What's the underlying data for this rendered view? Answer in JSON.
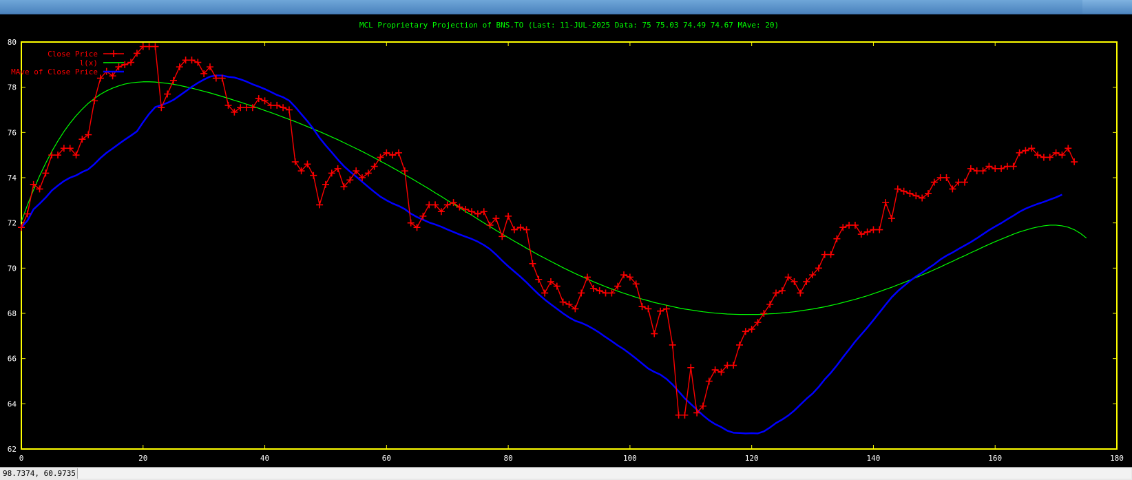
{
  "chart_data": {
    "type": "line",
    "title": "MCL Proprietary Projection of BNS.TO  (Last: 11-JUL-2025    Data: 75 75.03 74.49 74.67    MAve: 20)",
    "xlim": [
      0,
      180
    ],
    "ylim": [
      62,
      80
    ],
    "x_ticks": [
      "0",
      "20",
      "40",
      "60",
      "80",
      "100",
      "120",
      "140",
      "160",
      "180"
    ],
    "y_ticks": [
      "62",
      "64",
      "66",
      "68",
      "70",
      "72",
      "74",
      "76",
      "78",
      "80"
    ],
    "grid": false,
    "legend_position": "top-left",
    "series": [
      {
        "name": "Close Price",
        "color": "#ff0000",
        "marker": "+",
        "values": [
          71.8,
          72.4,
          73.7,
          73.5,
          74.2,
          75.0,
          75.0,
          75.3,
          75.3,
          75.0,
          75.7,
          75.9,
          77.4,
          78.4,
          78.7,
          78.5,
          78.9,
          79.0,
          79.1,
          79.5,
          79.8,
          79.8,
          79.8,
          77.1,
          77.7,
          78.3,
          78.9,
          79.2,
          79.2,
          79.1,
          78.6,
          78.9,
          78.4,
          78.4,
          77.2,
          76.9,
          77.1,
          77.1,
          77.1,
          77.5,
          77.4,
          77.2,
          77.2,
          77.1,
          77.0,
          74.7,
          74.3,
          74.6,
          74.1,
          72.8,
          73.7,
          74.2,
          74.4,
          73.6,
          73.9,
          74.3,
          74.0,
          74.2,
          74.5,
          74.9,
          75.1,
          75.0,
          75.1,
          74.3,
          72.0,
          71.8,
          72.3,
          72.8,
          72.8,
          72.5,
          72.8,
          72.9,
          72.7,
          72.6,
          72.5,
          72.4,
          72.5,
          71.9,
          72.2,
          71.4,
          72.3,
          71.7,
          71.8,
          71.7,
          70.2,
          69.5,
          68.9,
          69.4,
          69.2,
          68.5,
          68.4,
          68.2,
          68.9,
          69.6,
          69.1,
          69.0,
          68.9,
          68.9,
          69.2,
          69.7,
          69.6,
          69.3,
          68.3,
          68.2,
          67.1,
          68.1,
          68.2,
          66.6,
          63.5,
          63.5,
          65.6,
          63.6,
          63.9,
          65.0,
          65.5,
          65.4,
          65.7,
          65.7,
          66.6,
          67.2,
          67.3,
          67.6,
          68.0,
          68.4,
          68.9,
          69.0,
          69.6,
          69.4,
          68.9,
          69.4,
          69.7,
          70.0,
          70.6,
          70.6,
          71.3,
          71.8,
          71.9,
          71.9,
          71.5,
          71.6,
          71.7,
          71.7,
          72.9,
          72.2,
          73.5,
          73.4,
          73.3,
          73.2,
          73.1,
          73.3,
          73.8,
          74.0,
          74.0,
          73.5,
          73.8,
          73.8,
          74.4,
          74.3,
          74.3,
          74.5,
          74.4,
          74.4,
          74.5,
          74.5,
          75.1,
          75.2,
          75.3,
          75.0,
          74.9,
          74.9,
          75.1,
          75.0,
          75.3,
          74.7
        ]
      },
      {
        "name": "l(x)",
        "color": "#00ff00",
        "values": [
          72.06,
          72.79,
          73.46,
          74.08,
          74.64,
          75.16,
          75.62,
          76.04,
          76.41,
          76.74,
          77.03,
          77.29,
          77.5,
          77.69,
          77.84,
          77.96,
          78.06,
          78.14,
          78.19,
          78.22,
          78.24,
          78.24,
          78.23,
          78.2,
          78.17,
          78.13,
          78.08,
          78.02,
          77.96,
          77.89,
          77.82,
          77.75,
          77.67,
          77.59,
          77.51,
          77.42,
          77.34,
          77.25,
          77.16,
          77.07,
          76.97,
          76.88,
          76.78,
          76.68,
          76.58,
          76.48,
          76.37,
          76.26,
          76.15,
          76.04,
          75.92,
          75.8,
          75.68,
          75.55,
          75.42,
          75.29,
          75.16,
          75.02,
          74.88,
          74.73,
          74.59,
          74.44,
          74.29,
          74.13,
          73.98,
          73.82,
          73.66,
          73.5,
          73.33,
          73.17,
          73.0,
          72.84,
          72.67,
          72.5,
          72.34,
          72.17,
          72.0,
          71.84,
          71.67,
          71.51,
          71.35,
          71.19,
          71.04,
          70.88,
          70.73,
          70.58,
          70.44,
          70.3,
          70.16,
          70.02,
          69.89,
          69.76,
          69.64,
          69.52,
          69.4,
          69.29,
          69.18,
          69.08,
          68.98,
          68.89,
          68.8,
          68.71,
          68.63,
          68.56,
          68.48,
          68.42,
          68.36,
          68.3,
          68.24,
          68.19,
          68.15,
          68.11,
          68.07,
          68.04,
          68.01,
          67.99,
          67.97,
          67.96,
          67.95,
          67.95,
          67.95,
          67.95,
          67.96,
          67.98,
          67.99,
          68.02,
          68.04,
          68.07,
          68.11,
          68.15,
          68.19,
          68.24,
          68.29,
          68.35,
          68.41,
          68.48,
          68.55,
          68.62,
          68.7,
          68.78,
          68.87,
          68.96,
          69.06,
          69.15,
          69.26,
          69.36,
          69.47,
          69.58,
          69.7,
          69.81,
          69.93,
          70.05,
          70.18,
          70.3,
          70.43,
          70.55,
          70.68,
          70.8,
          70.93,
          71.05,
          71.17,
          71.28,
          71.39,
          71.5,
          71.6,
          71.68,
          71.76,
          71.82,
          71.87,
          71.9,
          71.9,
          71.87,
          71.81,
          71.7,
          71.54,
          71.33
        ]
      },
      {
        "name": "MAve of Close Price",
        "color": "#0000ff",
        "values": [
          71.8,
          72.1,
          72.6,
          72.85,
          73.12,
          73.43,
          73.65,
          73.85,
          74.0,
          74.1,
          74.25,
          74.37,
          74.6,
          74.87,
          75.1,
          75.29,
          75.49,
          75.68,
          75.86,
          76.05,
          76.45,
          76.82,
          77.12,
          77.21,
          77.31,
          77.44,
          77.63,
          77.82,
          78.02,
          78.19,
          78.34,
          78.47,
          78.52,
          78.52,
          78.46,
          78.43,
          78.35,
          78.25,
          78.13,
          78.03,
          77.92,
          77.79,
          77.66,
          77.56,
          77.41,
          77.13,
          76.81,
          76.5,
          76.15,
          75.76,
          75.43,
          75.12,
          74.8,
          74.51,
          74.27,
          74.05,
          73.82,
          73.59,
          73.37,
          73.16,
          73.0,
          72.86,
          72.75,
          72.61,
          72.41,
          72.26,
          72.14,
          72.02,
          71.93,
          71.83,
          71.71,
          71.6,
          71.49,
          71.39,
          71.29,
          71.17,
          71.02,
          70.84,
          70.6,
          70.33,
          70.08,
          69.85,
          69.62,
          69.37,
          69.1,
          68.84,
          68.61,
          68.4,
          68.2,
          68.0,
          67.82,
          67.67,
          67.58,
          67.46,
          67.31,
          67.14,
          66.95,
          66.77,
          66.58,
          66.41,
          66.21,
          66.0,
          65.78,
          65.56,
          65.41,
          65.29,
          65.1,
          64.85,
          64.55,
          64.24,
          63.99,
          63.74,
          63.49,
          63.27,
          63.1,
          62.97,
          62.81,
          62.72,
          62.71,
          62.69,
          62.7,
          62.69,
          62.78,
          62.95,
          63.15,
          63.3,
          63.48,
          63.7,
          63.96,
          64.22,
          64.45,
          64.74,
          65.08,
          65.37,
          65.7,
          66.06,
          66.4,
          66.75,
          67.06,
          67.37,
          67.7,
          68.04,
          68.38,
          68.71,
          68.98,
          69.21,
          69.43,
          69.63,
          69.8,
          69.99,
          70.17,
          70.38,
          70.55,
          70.69,
          70.85,
          71.0,
          71.15,
          71.32,
          71.5,
          71.68,
          71.84,
          71.99,
          72.16,
          72.32,
          72.49,
          72.63,
          72.74,
          72.84,
          72.93,
          73.03,
          73.13,
          73.25
        ]
      }
    ]
  },
  "status": {
    "coords": "98.7374,  60.9735"
  }
}
